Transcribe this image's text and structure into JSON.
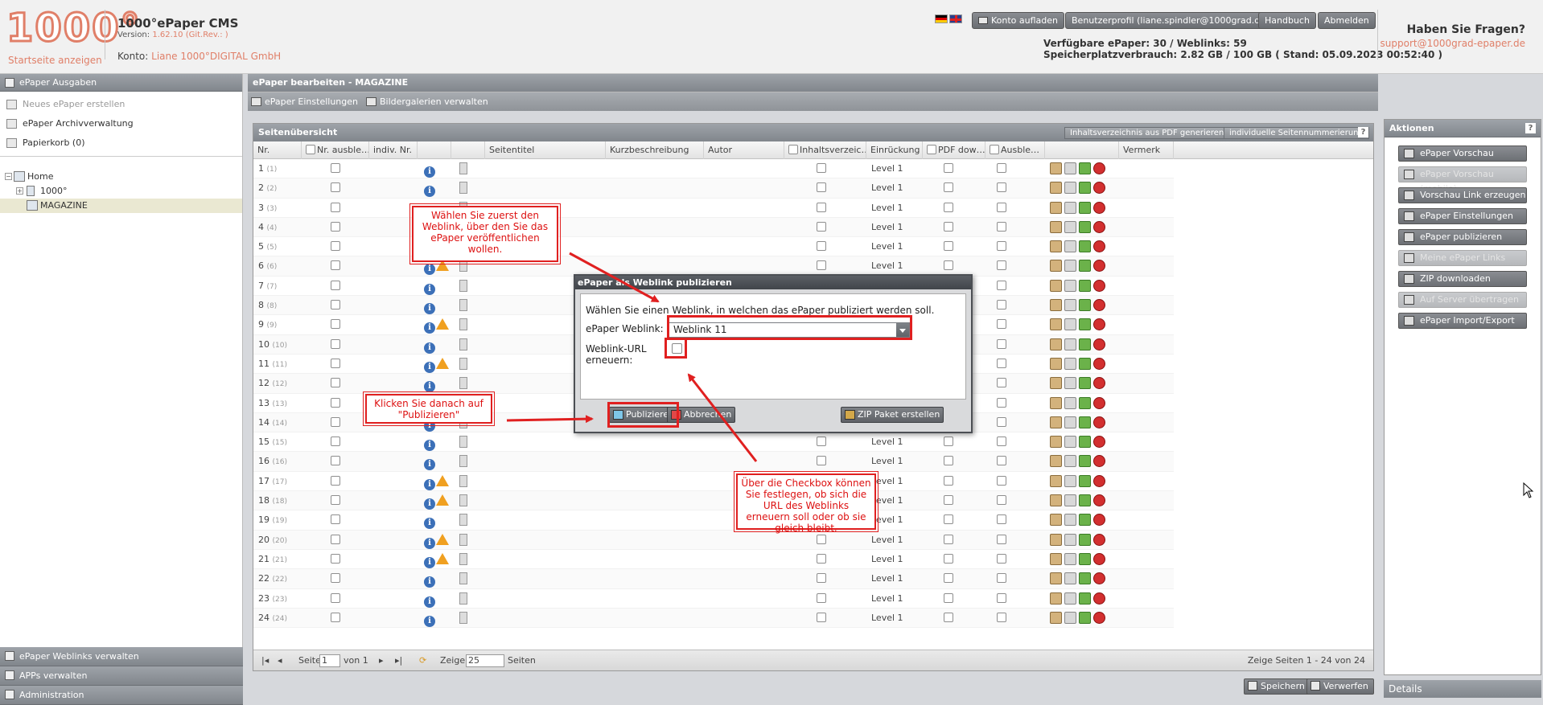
{
  "header": {
    "logo_text": "1000°",
    "startseite": "Startseite anzeigen",
    "title": "1000°ePaper CMS",
    "version_label": "Version:",
    "version_value": "1.62.10 (Git.Rev.: )",
    "konto_label": "Konto:",
    "konto_name": "Liane 1000°DIGITAL GmbH",
    "buttons": {
      "konto_aufladen": "Konto aufladen",
      "benutzerprofil": "Benutzerprofil (liane.spindler@1000grad.de)",
      "handbuch": "Handbuch",
      "abmelden": "Abmelden"
    },
    "stats_line1": "Verfügbare ePaper: 30 / Weblinks: 59",
    "stats_line2": "Speicherplatzverbrauch: 2.82 GB / 100 GB ( Stand: 05.09.2023 00:52:40 )",
    "help_title": "Haben Sie Fragen?",
    "help_email": "support@1000grad-epaper.de"
  },
  "sidebar": {
    "section_title": "ePaper Ausgaben",
    "items": [
      {
        "label": "Neues ePaper erstellen",
        "disabled": true
      },
      {
        "label": "ePaper Archivverwaltung",
        "disabled": false
      },
      {
        "label": "Papierkorb (0)",
        "disabled": false
      }
    ],
    "tree": {
      "home": "Home",
      "folder": "1000°",
      "selected": "MAGAZINE"
    },
    "bottom": {
      "weblinks": "ePaper Weblinks verwalten",
      "apps": "APPs verwalten",
      "admin": "Administration"
    }
  },
  "main": {
    "title": "ePaper bearbeiten - MAGAZINE",
    "tools": {
      "einstellungen": "ePaper Einstellungen",
      "bildergalerien": "Bildergalerien verwalten"
    },
    "grid_title": "Seitenübersicht",
    "grid_buttons": {
      "inhaltsverzeichnis": "Inhaltsverzeichnis aus PDF generieren",
      "seitennummerierung": "individuelle Seitennummerierung",
      "help": "?"
    },
    "columns": {
      "nr": "Nr.",
      "nr_ausblenden": "Nr. ausble…",
      "indiv_nr": "indiv. Nr.",
      "seitentitel": "Seitentitel",
      "kurzbeschreibung": "Kurzbeschreibung",
      "autor": "Autor",
      "inhaltsverzeichnis": "Inhaltsverzeic…",
      "einrueckung": "Einrückung",
      "pdf_download": "PDF dow…",
      "ausblenden": "Ausble…",
      "vermerk": "Vermerk"
    },
    "level_label": "Level 1",
    "rows": [
      {
        "nr": "1",
        "sub": "(1)",
        "warn": false
      },
      {
        "nr": "2",
        "sub": "(2)",
        "warn": false
      },
      {
        "nr": "3",
        "sub": "(3)",
        "warn": false
      },
      {
        "nr": "4",
        "sub": "(4)",
        "warn": false
      },
      {
        "nr": "5",
        "sub": "(5)",
        "warn": false
      },
      {
        "nr": "6",
        "sub": "(6)",
        "warn": true
      },
      {
        "nr": "7",
        "sub": "(7)",
        "warn": false
      },
      {
        "nr": "8",
        "sub": "(8)",
        "warn": false
      },
      {
        "nr": "9",
        "sub": "(9)",
        "warn": true
      },
      {
        "nr": "10",
        "sub": "(10)",
        "warn": false
      },
      {
        "nr": "11",
        "sub": "(11)",
        "warn": true
      },
      {
        "nr": "12",
        "sub": "(12)",
        "warn": false
      },
      {
        "nr": "13",
        "sub": "(13)",
        "warn": false
      },
      {
        "nr": "14",
        "sub": "(14)",
        "warn": false
      },
      {
        "nr": "15",
        "sub": "(15)",
        "warn": false
      },
      {
        "nr": "16",
        "sub": "(16)",
        "warn": false
      },
      {
        "nr": "17",
        "sub": "(17)",
        "warn": true
      },
      {
        "nr": "18",
        "sub": "(18)",
        "warn": true
      },
      {
        "nr": "19",
        "sub": "(19)",
        "warn": false
      },
      {
        "nr": "20",
        "sub": "(20)",
        "warn": true
      },
      {
        "nr": "21",
        "sub": "(21)",
        "warn": true
      },
      {
        "nr": "22",
        "sub": "(22)",
        "warn": false
      },
      {
        "nr": "23",
        "sub": "(23)",
        "warn": false
      },
      {
        "nr": "24",
        "sub": "(24)",
        "warn": false
      }
    ],
    "pager": {
      "seite": "Seite",
      "current": "1",
      "von": "von 1",
      "zeige": "Zeige",
      "per_page": "25",
      "seiten": "Seiten",
      "summary": "Zeige Seiten 1 - 24 von 24"
    },
    "footer": {
      "speichern": "Speichern",
      "verwerfen": "Verwerfen"
    }
  },
  "aktionen": {
    "title": "Aktionen",
    "help": "?",
    "buttons": [
      {
        "label": "ePaper Vorschau",
        "disabled": false,
        "icon": "preview-icon"
      },
      {
        "label": "ePaper Vorschau (mobile)",
        "disabled": true,
        "icon": "mobile-icon"
      },
      {
        "label": "Vorschau Link erzeugen",
        "disabled": false,
        "icon": "link-icon"
      },
      {
        "label": "ePaper Einstellungen",
        "disabled": false,
        "icon": "settings-icon"
      },
      {
        "label": "ePaper publizieren",
        "disabled": false,
        "icon": "publish-icon"
      },
      {
        "label": "Meine ePaper Links",
        "disabled": true,
        "icon": "links-icon"
      },
      {
        "label": "ZIP downloaden",
        "disabled": false,
        "icon": "zip-icon"
      },
      {
        "label": "Auf Server übertragen",
        "disabled": true,
        "icon": "server-icon"
      },
      {
        "label": "ePaper Import/Export",
        "disabled": false,
        "icon": "import-export-icon"
      }
    ],
    "details": "Details"
  },
  "modal": {
    "title": "ePaper als Weblink publizieren",
    "intro": "Wählen Sie einen Weblink, in welchen das ePaper publiziert werden soll.",
    "weblink_label": "ePaper Weblink:",
    "weblink_value": "Weblink 11",
    "renew_label": "Weblink-URL erneuern:",
    "buttons": {
      "publizieren": "Publizieren",
      "abbrechen": "Abbrechen",
      "zip": "ZIP Paket erstellen"
    }
  },
  "annotations": {
    "callout1": "Wählen Sie zuerst den Weblink, über den Sie das ePaper veröffentlichen wollen.",
    "callout2": "Klicken Sie danach auf \"Publizieren\"",
    "callout3": "Über die Checkbox können Sie festlegen, ob sich die URL des Weblinks erneuern soll oder ob sie gleich bleibt."
  },
  "colors": {
    "accent": "#e07f68",
    "annotation_red": "#e02020",
    "panel_header": "#8a8f95"
  }
}
